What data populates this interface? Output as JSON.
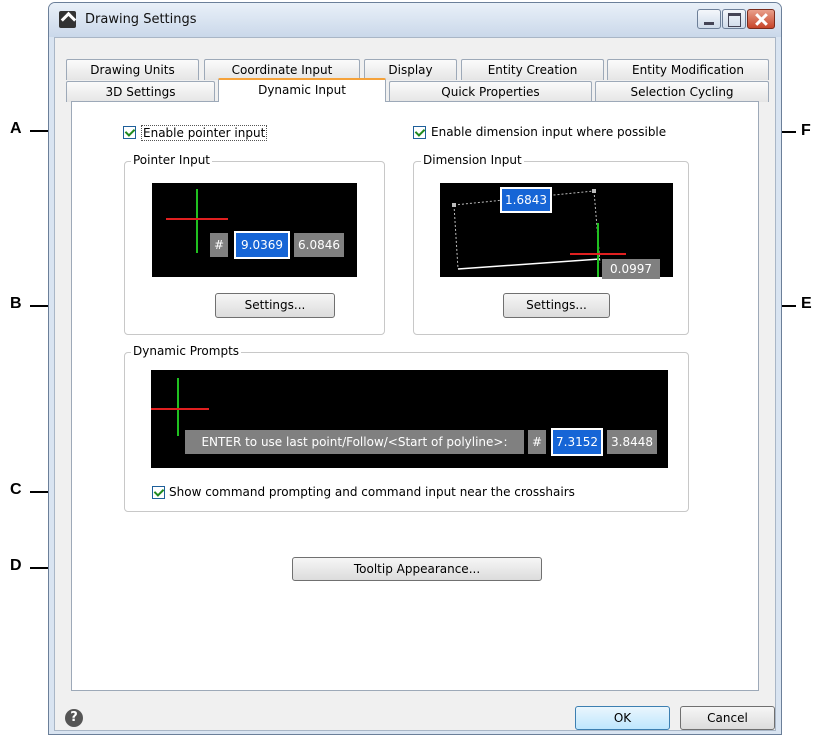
{
  "window": {
    "title": "Drawing Settings"
  },
  "tabs": {
    "row1": [
      "Drawing Units",
      "Coordinate Input",
      "Display",
      "Entity Creation",
      "Entity Modification"
    ],
    "row2": [
      "3D Settings",
      "Dynamic Input",
      "Quick Properties",
      "Selection Cycling"
    ],
    "active": "Dynamic Input"
  },
  "pointer": {
    "checkbox_label": "Enable pointer input",
    "checked": true,
    "group_title": "Pointer Input",
    "hash": "#",
    "x_value": "9.0369",
    "y_value": "6.0846",
    "settings_label": "Settings..."
  },
  "dimension": {
    "checkbox_label": "Enable dimension input where possible",
    "checked": true,
    "group_title": "Dimension Input",
    "length_value": "1.6843",
    "angle_value": "0.0997",
    "settings_label": "Settings..."
  },
  "prompts": {
    "group_title": "Dynamic Prompts",
    "prompt_text": "ENTER to use last point/Follow/<Start of polyline>:",
    "hash": "#",
    "x_value": "7.3152",
    "y_value": "3.8448",
    "checkbox_label": "Show command prompting and command input near the crosshairs",
    "checked": true
  },
  "tooltip_button": "Tooltip Appearance...",
  "footer": {
    "ok": "OK",
    "cancel": "Cancel",
    "help_glyph": "?"
  },
  "callouts": {
    "a": "A",
    "b": "B",
    "c": "C",
    "d": "D",
    "e": "E",
    "f": "F"
  },
  "colors": {
    "crosshair_red": "#e02020",
    "crosshair_green": "#20c020",
    "selection_blue": "#1665d6",
    "active_tab_accent": "#f5a23a"
  }
}
